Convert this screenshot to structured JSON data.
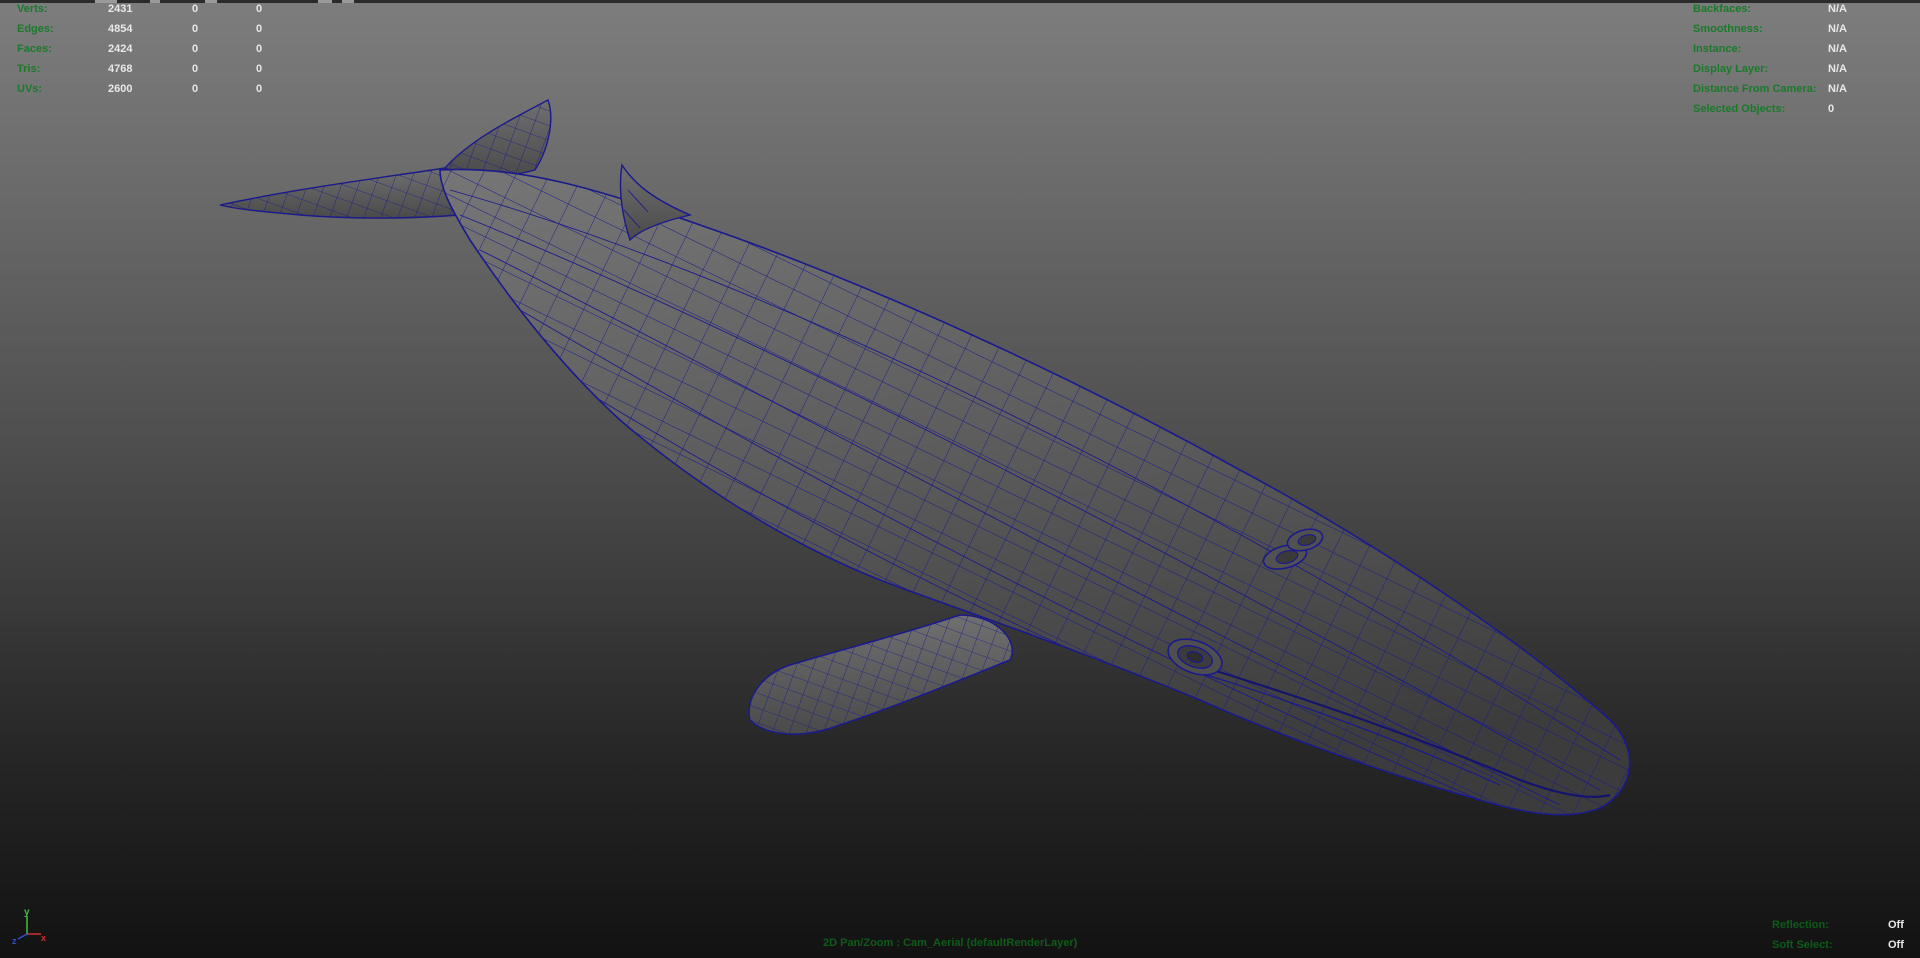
{
  "stats": {
    "rows": [
      {
        "label": "Verts:",
        "values": [
          "2431",
          "0",
          "0"
        ]
      },
      {
        "label": "Edges:",
        "values": [
          "4854",
          "0",
          "0"
        ]
      },
      {
        "label": "Faces:",
        "values": [
          "2424",
          "0",
          "0"
        ]
      },
      {
        "label": "Tris:",
        "values": [
          "4768",
          "0",
          "0"
        ]
      },
      {
        "label": "UVs:",
        "values": [
          "2600",
          "0",
          "0"
        ]
      }
    ]
  },
  "info": {
    "rows": [
      {
        "label": "Backfaces:",
        "value": "N/A"
      },
      {
        "label": "Smoothness:",
        "value": "N/A"
      },
      {
        "label": "Instance:",
        "value": "N/A"
      },
      {
        "label": "Display Layer:",
        "value": "N/A"
      },
      {
        "label": "Distance From Camera:",
        "value": "N/A"
      },
      {
        "label": "Selected Objects:",
        "value": "0"
      }
    ]
  },
  "status": {
    "rows": [
      {
        "label": "Reflection:",
        "value": "Off"
      },
      {
        "label": "Soft Select:",
        "value": "Off"
      }
    ]
  },
  "camera": {
    "label": "2D Pan/Zoom : Cam_Aerial (defaultRenderLayer)"
  },
  "axis": {
    "y_label": "y",
    "x_label": "x",
    "z_label": "z"
  },
  "colors": {
    "wire": "#1a1a8c",
    "hud_label": "#1a7a2a",
    "hud_value": "#e8e8e8"
  }
}
